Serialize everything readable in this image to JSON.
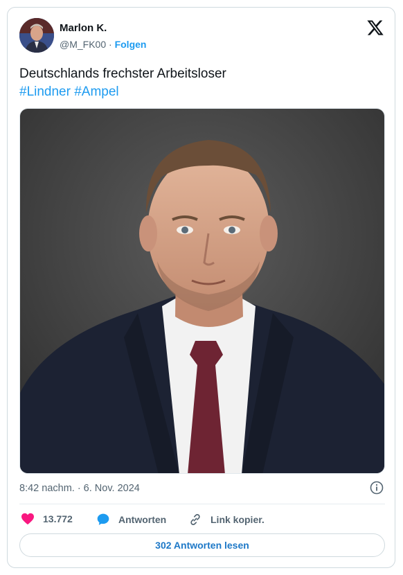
{
  "author": {
    "name": "Marlon K.",
    "handle": "@M_FK00",
    "separator": "·",
    "follow_label": "Folgen"
  },
  "tweet": {
    "text": "Deutschlands frechster Arbeitsloser",
    "hashtags": [
      "#Lindner",
      "#Ampel"
    ],
    "timestamp": "8:42 nachm. · 6. Nov. 2024"
  },
  "actions": {
    "like_count": "13.772",
    "reply_label": "Antworten",
    "copy_link_label": "Link kopier."
  },
  "read_replies_label": "302 Antworten lesen",
  "icons": [
    "x-logo-icon",
    "heart-icon",
    "reply-bubble-icon",
    "link-icon",
    "info-icon"
  ],
  "colors": {
    "accent": "#1d9bf0",
    "like": "#f91880",
    "text": "#0f1419",
    "muted": "#536471",
    "border": "#cfd9de"
  }
}
